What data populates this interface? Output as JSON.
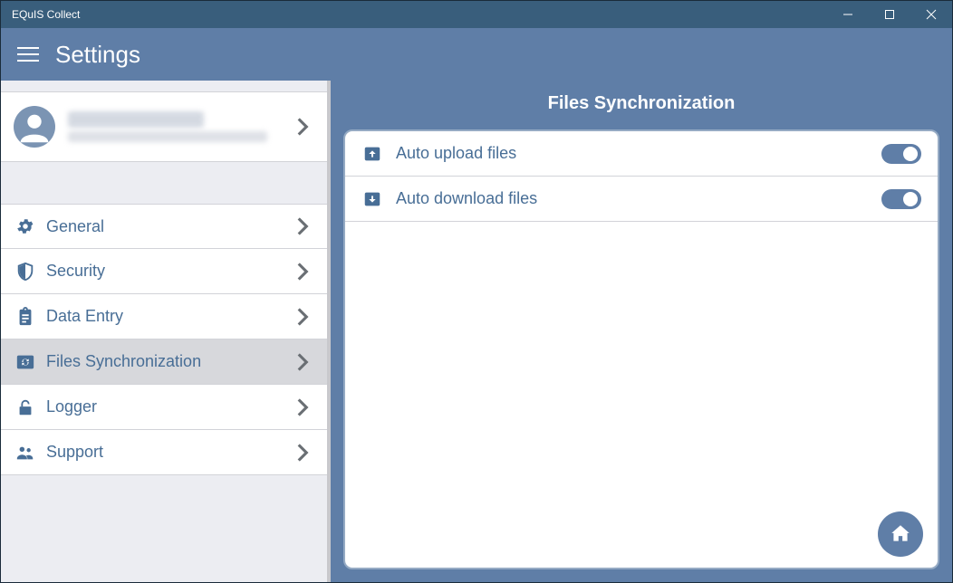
{
  "window": {
    "title": "EQuIS Collect"
  },
  "header": {
    "title": "Settings"
  },
  "user": {
    "name": "",
    "email": ""
  },
  "sidebar": {
    "items": [
      {
        "label": "General"
      },
      {
        "label": "Security"
      },
      {
        "label": "Data Entry"
      },
      {
        "label": "Files Synchronization"
      },
      {
        "label": "Logger"
      },
      {
        "label": "Support"
      }
    ]
  },
  "main": {
    "title": "Files Synchronization",
    "options": [
      {
        "label": "Auto upload files",
        "on": true
      },
      {
        "label": "Auto download files",
        "on": true
      }
    ]
  }
}
